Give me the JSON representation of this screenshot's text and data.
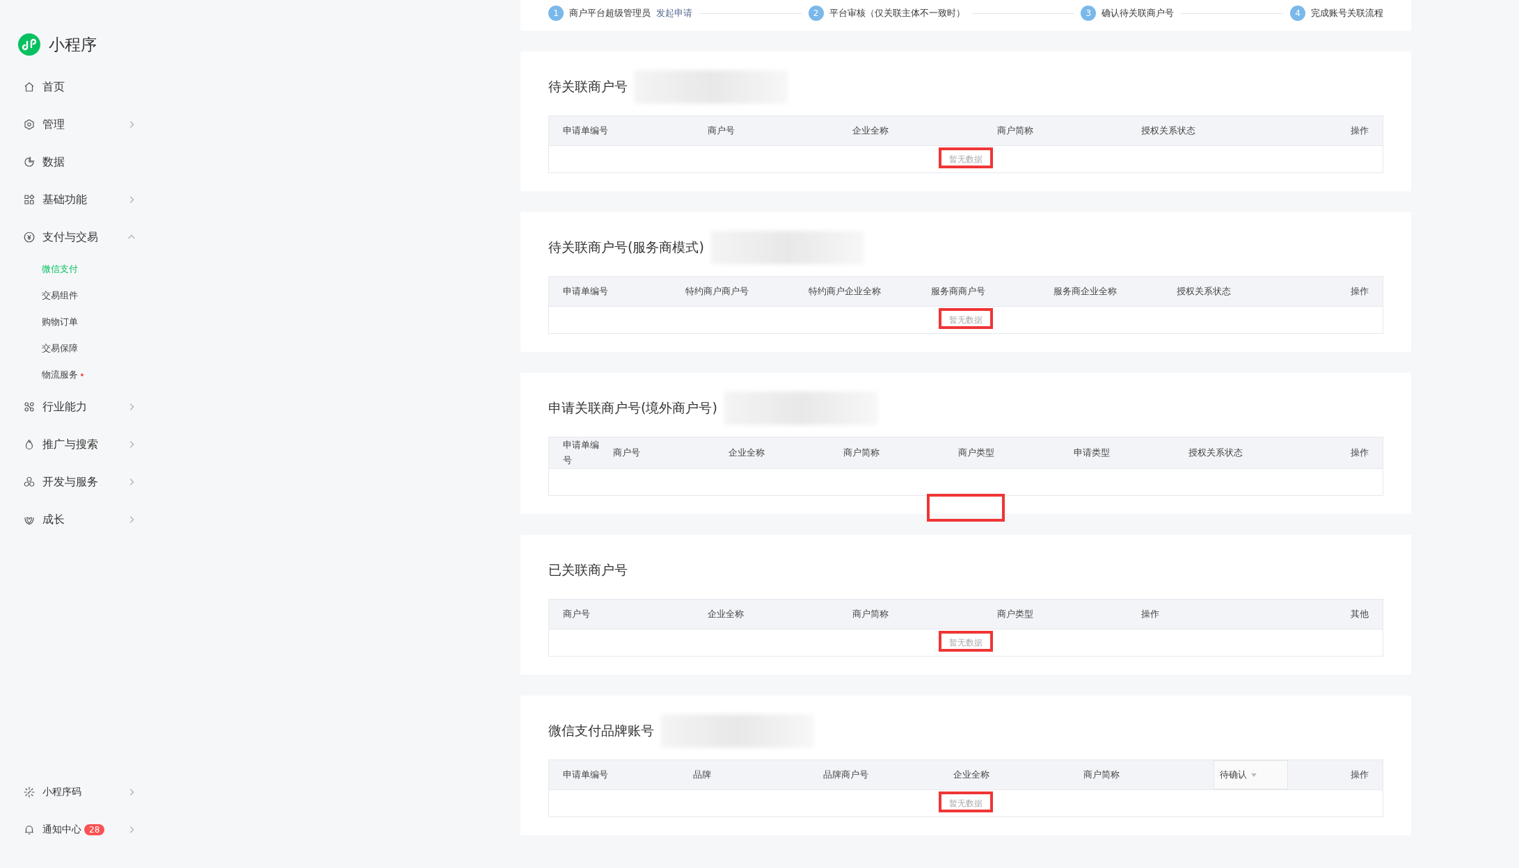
{
  "sidebar": {
    "title": "小程序",
    "items": [
      {
        "kind": "link",
        "label": "首页"
      },
      {
        "kind": "group",
        "label": "管理",
        "expanded": false
      },
      {
        "kind": "link",
        "label": "数据"
      },
      {
        "kind": "group",
        "label": "基础功能",
        "expanded": false
      },
      {
        "kind": "group",
        "label": "支付与交易",
        "expanded": true,
        "children": [
          {
            "label": "微信支付",
            "selected": true,
            "dot": false
          },
          {
            "label": "交易组件",
            "selected": false,
            "dot": false
          },
          {
            "label": "购物订单",
            "selected": false,
            "dot": false
          },
          {
            "label": "交易保障",
            "selected": false,
            "dot": false
          },
          {
            "label": "物流服务",
            "selected": false,
            "dot": true
          }
        ]
      },
      {
        "kind": "group",
        "label": "行业能力",
        "expanded": false
      },
      {
        "kind": "group",
        "label": "推广与搜索",
        "expanded": false
      },
      {
        "kind": "group",
        "label": "开发与服务",
        "expanded": false
      },
      {
        "kind": "group",
        "label": "成长",
        "expanded": false
      }
    ],
    "bottom_items": [
      {
        "label": "小程序码"
      },
      {
        "label": "通知中心",
        "badge": "28"
      }
    ]
  },
  "steps": [
    {
      "number": "1",
      "text": "商户平台超级管理员",
      "link": "发起申请"
    },
    {
      "number": "2",
      "text": "平台审核（仅关联主体不一致时）"
    },
    {
      "number": "3",
      "text": "确认待关联商户号"
    },
    {
      "number": "4",
      "text": "完成账号关联流程"
    }
  ],
  "sections": [
    {
      "title": "待关联商户号",
      "redacted": true,
      "table": {
        "columns": [
          {
            "label": "申请单编号"
          },
          {
            "label": "商户号"
          },
          {
            "label": "企业全称"
          },
          {
            "label": "商户简称"
          },
          {
            "label": "授权关系状态"
          },
          {
            "label": "操作"
          }
        ],
        "empty_text": "暂无数据",
        "highlighted": true
      }
    },
    {
      "title": "待关联商户号(服务商模式)",
      "redacted": true,
      "table": {
        "columns": [
          {
            "label": "申请单编号"
          },
          {
            "label": "特约商户商户号"
          },
          {
            "label": "特约商户企业全称"
          },
          {
            "label": "服务商商户号"
          },
          {
            "label": "服务商企业全称"
          },
          {
            "label": "授权关系状态"
          },
          {
            "label": "操作"
          }
        ],
        "empty_text": "暂无数据",
        "highlighted": true
      }
    },
    {
      "title": "申请关联商户号(境外商户号)",
      "redacted": true,
      "table": {
        "columns": [
          {
            "label": "申请单编号"
          },
          {
            "label": "商户号"
          },
          {
            "label": "企业全称"
          },
          {
            "label": "商户简称"
          },
          {
            "label": "商户类型"
          },
          {
            "label": "申请类型"
          },
          {
            "label": "授权关系状态"
          },
          {
            "label": "操作"
          }
        ],
        "highlighted": true
      }
    },
    {
      "title": "已关联商户号",
      "redacted": false,
      "table": {
        "columns": [
          {
            "label": "商户号"
          },
          {
            "label": "企业全称"
          },
          {
            "label": "商户简称"
          },
          {
            "label": "商户类型"
          },
          {
            "label": "操作"
          },
          {
            "label": "其他"
          }
        ],
        "empty_text": "暂无数据",
        "highlighted": true
      }
    },
    {
      "title": "微信支付品牌账号",
      "redacted": true,
      "table": {
        "columns": [
          {
            "label": "申请单编号"
          },
          {
            "label": "品牌"
          },
          {
            "label": "品牌商户号"
          },
          {
            "label": "企业全称"
          },
          {
            "label": "商户简称"
          },
          {
            "label": "待确认",
            "kind": "filter"
          },
          {
            "label": "操作"
          }
        ],
        "empty_text": "暂无数据",
        "highlighted": true
      }
    }
  ]
}
